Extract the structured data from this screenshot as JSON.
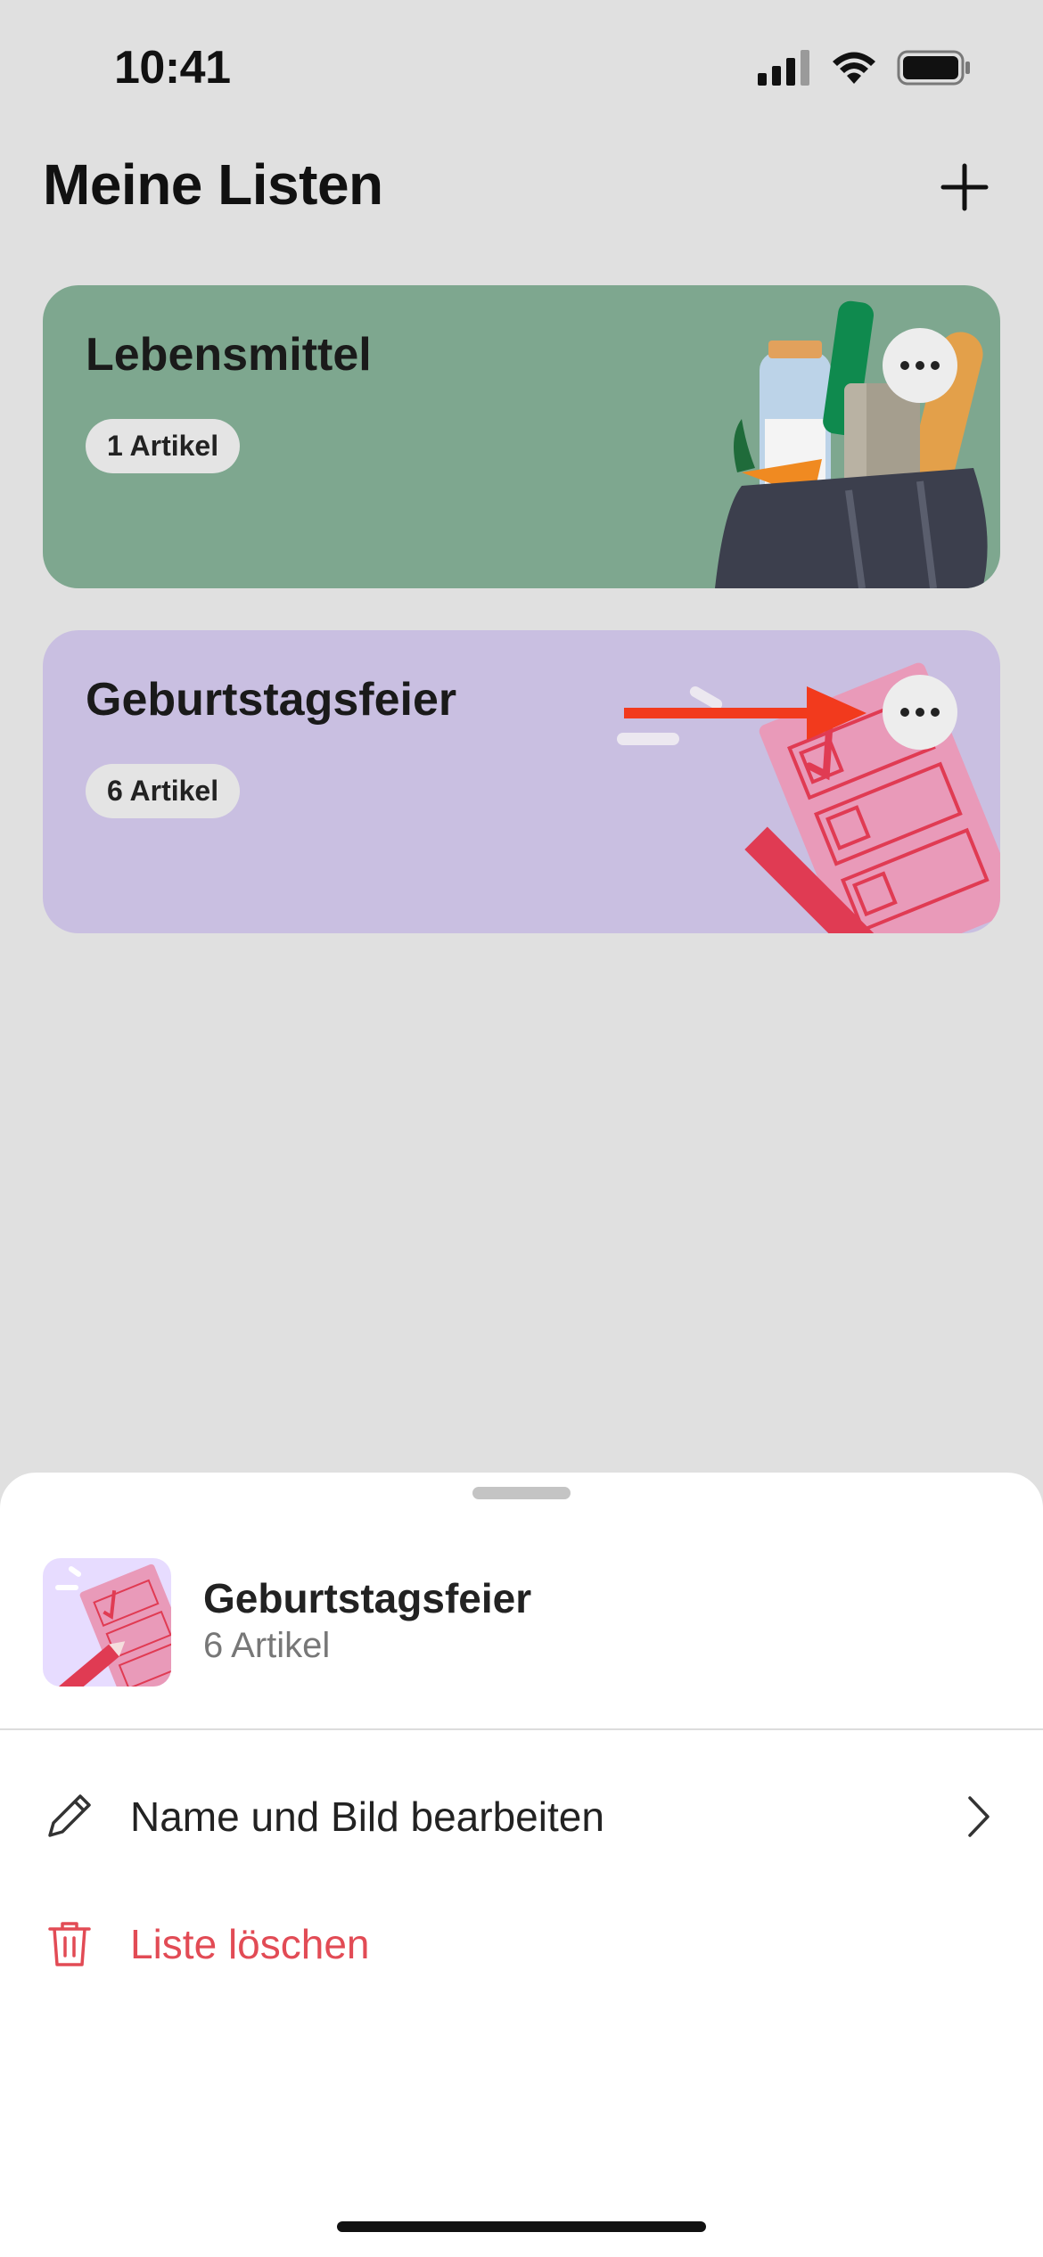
{
  "status_bar": {
    "time": "10:41",
    "icons": [
      "signal-icon",
      "wifi-icon",
      "battery-icon"
    ]
  },
  "header": {
    "title": "Meine Listen",
    "add_icon": "plus-icon"
  },
  "lists": [
    {
      "title": "Lebensmittel",
      "badge": "1 Artikel",
      "color": "#7ea78f",
      "illustration": "grocery-bag"
    },
    {
      "title": "Geburtstagsfeier",
      "badge": "6 Artikel",
      "color": "#c9bfe1",
      "illustration": "checklist-pencil"
    }
  ],
  "sheet": {
    "title": "Geburtstagsfeier",
    "subtitle": "6 Artikel",
    "actions": [
      {
        "label": "Name und Bild bearbeiten",
        "icon": "pencil-icon",
        "has_chevron": true
      },
      {
        "label": "Liste löschen",
        "icon": "trash-icon",
        "color": "#e24b55"
      }
    ]
  },
  "colors": {
    "background": "#e0e0e0",
    "destructive": "#e24b55",
    "annotation_arrow": "#f23a1d"
  }
}
